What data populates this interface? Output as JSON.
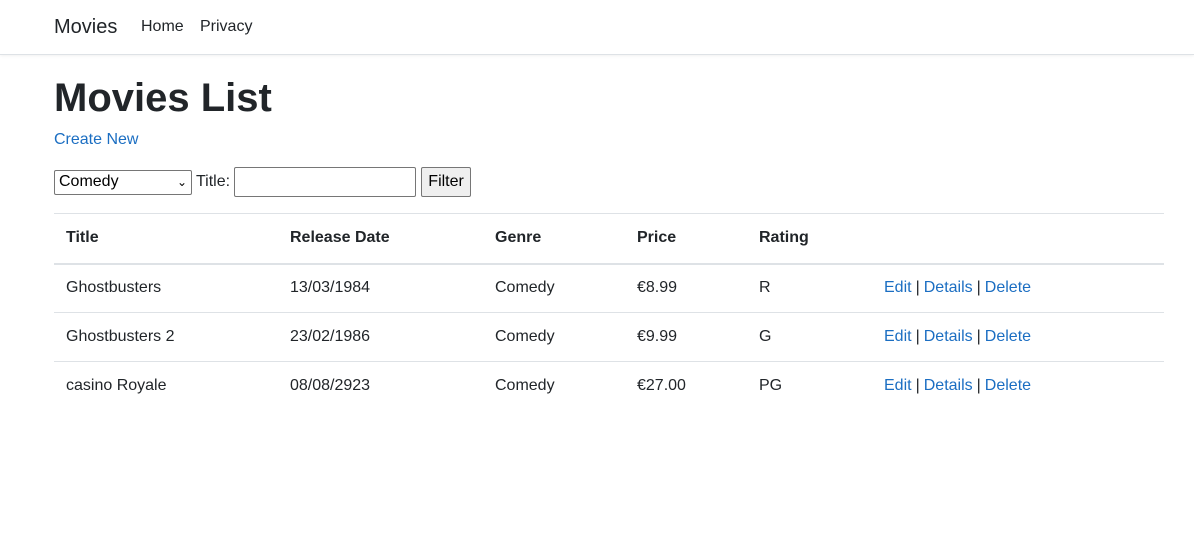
{
  "navbar": {
    "brand": "Movies",
    "links": [
      {
        "label": "Home"
      },
      {
        "label": "Privacy"
      }
    ]
  },
  "page": {
    "title": "Movies List",
    "create_link": "Create New"
  },
  "filter": {
    "genre_selected": "Comedy",
    "title_label": "Title:",
    "title_value": "",
    "button_label": "Filter"
  },
  "table": {
    "headers": [
      "Title",
      "Release Date",
      "Genre",
      "Price",
      "Rating",
      ""
    ],
    "rows": [
      {
        "title": "Ghostbusters",
        "release_date": "13/03/1984",
        "genre": "Comedy",
        "price": "€8.99",
        "rating": "R"
      },
      {
        "title": "Ghostbusters 2",
        "release_date": "23/02/1986",
        "genre": "Comedy",
        "price": "€9.99",
        "rating": "G"
      },
      {
        "title": "casino Royale",
        "release_date": "08/08/2923",
        "genre": "Comedy",
        "price": "€27.00",
        "rating": "PG"
      }
    ],
    "actions": {
      "edit": "Edit",
      "details": "Details",
      "delete": "Delete",
      "separator": "|"
    }
  },
  "colors": {
    "link": "#1b6ec2",
    "text": "#212529",
    "border": "#dee2e6"
  }
}
